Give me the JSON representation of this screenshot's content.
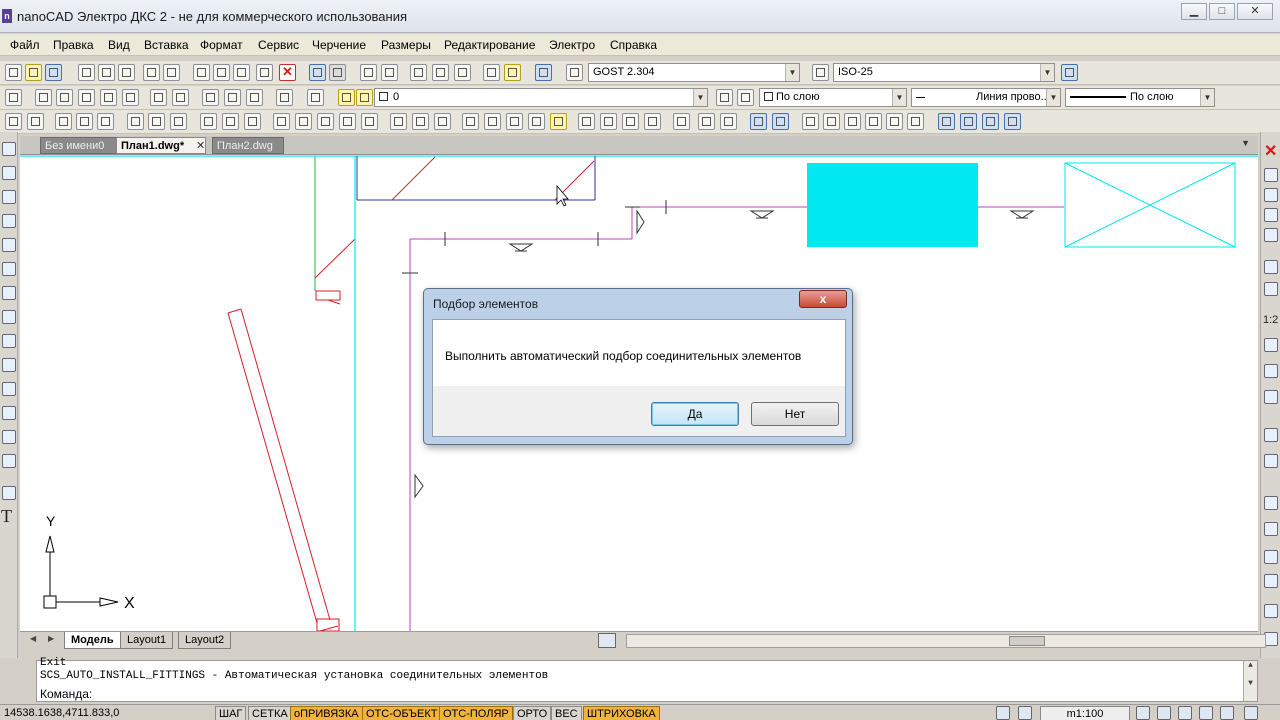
{
  "window": {
    "icon_letter": "n",
    "title": "nanoCAD Электро ДКС 2 - не для коммерческого использования",
    "minimize": "▁",
    "maximize": "□",
    "close": "✕"
  },
  "menu": [
    "Файл",
    "Правка",
    "Вид",
    "Вставка",
    "Формат",
    "Сервис",
    "Черчение",
    "Размеры",
    "Редактирование",
    "Электро",
    "Справка"
  ],
  "toolbar": {
    "text_style": "GOST 2.304",
    "dim_style": "ISO-25",
    "layer": "0",
    "color": "По слою",
    "linetype": "Линия прово...",
    "lineweight": "По слою"
  },
  "tabs": {
    "items": [
      "Без имени0",
      "План1.dwg*",
      "План2.dwg"
    ],
    "active_index": 1
  },
  "left_toolbar": {
    "text_tool": "T"
  },
  "right_toolbar": {
    "scale_label": "1:2"
  },
  "canvas": {
    "colors": {
      "magenta": "#c040c0",
      "cyan": "#00e8f0",
      "red": "#d4202a",
      "green": "#20b040",
      "navy": "#3030a0"
    },
    "ucs": {
      "x_label": "X",
      "y_label": "Y"
    }
  },
  "layout_tabs": [
    "Модель",
    "Layout1",
    "Layout2"
  ],
  "command": {
    "line_top": "Exit",
    "line_main": "SCS_AUTO_INSTALL_FITTINGS - Автоматическая установка соединительных элементов",
    "prompt": "Команда:"
  },
  "status": {
    "coords": "14538.1638,4711.833,0",
    "buttons": [
      {
        "label": "ШАГ",
        "on": false
      },
      {
        "label": "СЕТКА",
        "on": false
      },
      {
        "label": "оПРИВЯЗКА",
        "on": true
      },
      {
        "label": "ОТС-ОБЪЕКТ",
        "on": true
      },
      {
        "label": "ОТС-ПОЛЯР",
        "on": true
      },
      {
        "label": "ОРТО",
        "on": false
      },
      {
        "label": "ВЕС",
        "on": false
      },
      {
        "label": "ШТРИХОВКА",
        "on": true
      }
    ],
    "scale": "m1:100"
  },
  "dialog": {
    "title": "Подбор элементов",
    "close": "x",
    "message": "Выполнить автоматический подбор соединительных элементов",
    "yes": "Да",
    "no": "Нет"
  }
}
